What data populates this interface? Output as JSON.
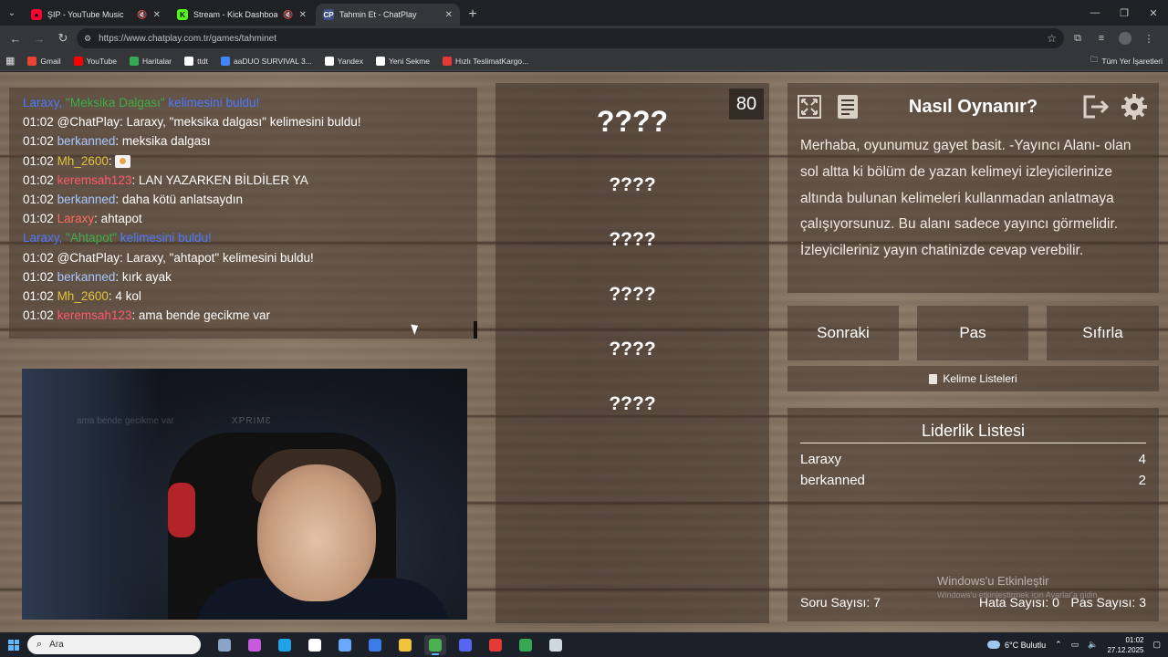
{
  "browser": {
    "tabs": [
      {
        "title": "ŞIP - YouTube Music",
        "fav_color": "#ff0033",
        "fav_glyph": "●",
        "muted": true,
        "active": false
      },
      {
        "title": "Stream - Kick Dashboard",
        "fav_color": "#53fc18",
        "fav_glyph": "K",
        "muted": true,
        "active": false
      },
      {
        "title": "Tahmin Et - ChatPlay",
        "fav_color": "#3c4f8a",
        "fav_glyph": "CP",
        "muted": false,
        "active": true
      }
    ],
    "url": "https://www.chatplay.com.tr/games/tahminet",
    "bookmarks": [
      {
        "label": "Gmail",
        "color": "#ea4335"
      },
      {
        "label": "YouTube",
        "color": "#ff0000"
      },
      {
        "label": "Haritalar",
        "color": "#34a853"
      },
      {
        "label": "ttdt",
        "color": "#ffffff"
      },
      {
        "label": "aaDUO SURVIVAL 3...",
        "color": "#4285f4"
      },
      {
        "label": "Yandex",
        "color": "#ffffff"
      },
      {
        "label": "Yeni Sekme",
        "color": "#ffffff"
      },
      {
        "label": "Hızlı TeslimatKargo...",
        "color": "#e53935"
      }
    ],
    "bookmarks_all": "Tüm Yer İşaretleri"
  },
  "chat": {
    "messages": [
      {
        "kind": "found",
        "user": "Laraxy",
        "word": "\"Meksika Dalgası\"",
        "text": " kelimesini buldu!"
      },
      {
        "kind": "msg",
        "time": "01:02",
        "user": "@ChatPlay",
        "user_color": "#ffffff",
        "text": ": Laraxy, \"meksika dalgası\" kelimesini buldu!"
      },
      {
        "kind": "msg",
        "time": "01:02",
        "user": "berkanned",
        "user_color": "#a9c7ff",
        "text": ": meksika dalgası"
      },
      {
        "kind": "msg",
        "time": "01:02",
        "user": "Mh_2600",
        "user_color": "#e0c23a",
        "text": ": ",
        "emote": true
      },
      {
        "kind": "msg",
        "time": "01:02",
        "user": "keremsah123",
        "user_color": "#ff5a6e",
        "text": ": LAN YAZARKEN BİLDİLER YA"
      },
      {
        "kind": "msg",
        "time": "01:02",
        "user": "berkanned",
        "user_color": "#a9c7ff",
        "text": ": daha kötü anlatsaydın"
      },
      {
        "kind": "msg",
        "time": "01:02",
        "user": "Laraxy",
        "user_color": "#ff6b5e",
        "text": ": ahtapot"
      },
      {
        "kind": "found",
        "user": "Laraxy",
        "word": "\"Ahtapot\"",
        "text": " kelimesini buldu!"
      },
      {
        "kind": "msg",
        "time": "01:02",
        "user": "@ChatPlay",
        "user_color": "#ffffff",
        "text": ": Laraxy, \"ahtapot\" kelimesini buldu!"
      },
      {
        "kind": "msg",
        "time": "01:02",
        "user": "berkanned",
        "user_color": "#a9c7ff",
        "text": ": kırk ayak"
      },
      {
        "kind": "msg",
        "time": "01:02",
        "user": "Mh_2600",
        "user_color": "#e0c23a",
        "text": ": 4 kol"
      },
      {
        "kind": "msg",
        "time": "01:02",
        "user": "keremsah123",
        "user_color": "#ff5a6e",
        "text": ": ama bende gecikme var"
      }
    ]
  },
  "webcam": {
    "overlay_text": "ama bende gecikme var",
    "brand_text": "XPRIMƐ"
  },
  "game": {
    "timer": "80",
    "main_word": "????",
    "forbidden_words": [
      "????",
      "????",
      "????",
      "????",
      "????"
    ]
  },
  "howto": {
    "title": "Nasıl Oynanır?",
    "body": "Merhaba, oyunumuz gayet basit. -Yayıncı Alanı- olan sol altta ki bölüm de yazan kelimeyi izleyicilerinize altında bulunan kelimeleri kullanmadan anlatmaya çalışıyorsunuz. Bu alanı sadece yayıncı görmelidir. İzleyicileriniz yayın chatinizde cevap verebilir."
  },
  "controls": {
    "next": "Sonraki",
    "pass": "Pas",
    "reset": "Sıfırla",
    "word_lists": "Kelime Listeleri"
  },
  "leaderboard": {
    "title": "Liderlik Listesi",
    "rows": [
      {
        "name": "Laraxy",
        "score": "4"
      },
      {
        "name": "berkanned",
        "score": "2"
      }
    ],
    "question_count": "Soru Sayısı: 7",
    "error_count": "Hata Sayısı: 0",
    "pass_count": "Pas Sayısı: 3",
    "watermark_title": "Windows'u Etkinleştir",
    "watermark_sub": "Windows'u etkinleştirmek için Ayarlar'a gidin."
  },
  "taskbar": {
    "search_placeholder": "Ara",
    "weather": "6°C  Bulutlu",
    "time": "01:02",
    "date": "27.12.2025",
    "apps": [
      "#8aa4c8",
      "#c55bdc",
      "#1fa3e6",
      "#ffffff",
      "#6aa7ff",
      "#3d7be8",
      "#f3c33d",
      "#4caf50",
      "#5865f2",
      "#e53935",
      "#34a853",
      "#cfd8dc"
    ]
  }
}
